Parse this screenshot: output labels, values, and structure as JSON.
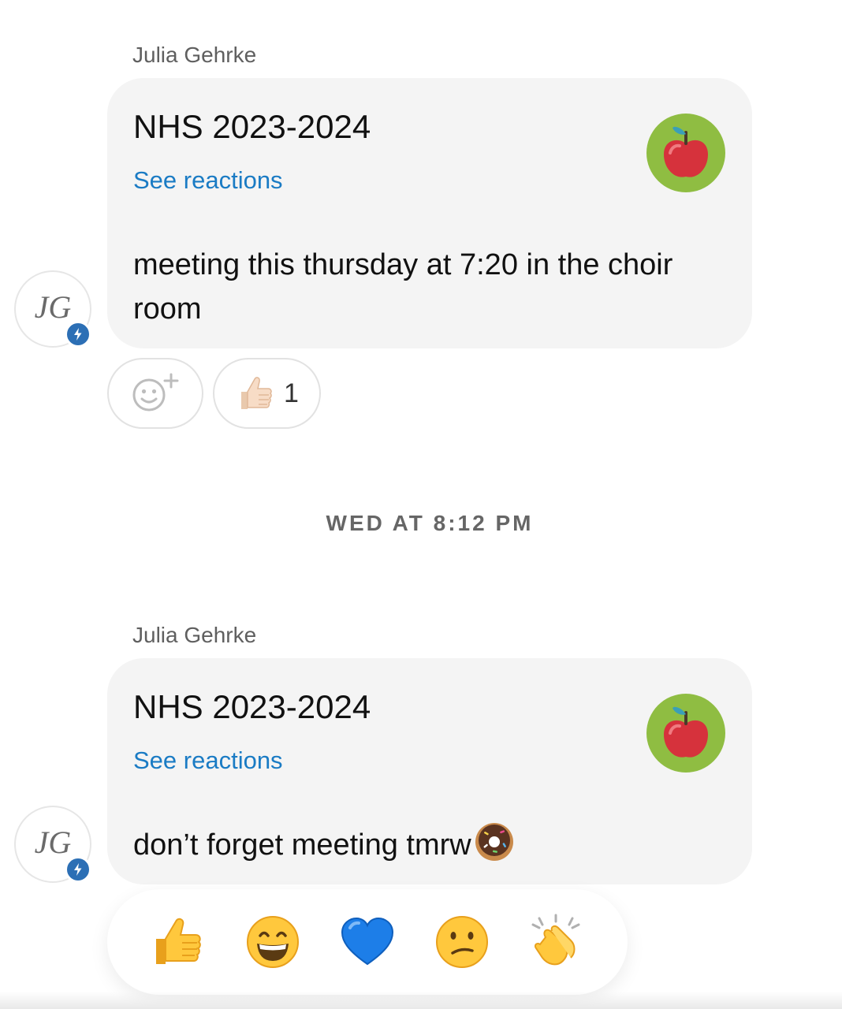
{
  "messages": [
    {
      "sender": "Julia Gehrke",
      "group_title": "NHS 2023-2024",
      "see_reactions": "See reactions",
      "group_icon": "apple-icon",
      "text": "meeting this thursday at 7:20 in the choir room",
      "avatar_initials": "JG",
      "reactions": [
        {
          "emoji": "thumbs-up-light-skin-icon",
          "count": "1"
        }
      ]
    },
    {
      "sender": "Julia Gehrke",
      "group_title": "NHS 2023-2024",
      "see_reactions": "See reactions",
      "group_icon": "apple-icon",
      "text": "don’t forget meeting tmrw",
      "text_emoji": "donut-icon",
      "avatar_initials": "JG"
    }
  ],
  "timestamp": "WED AT 8:12 PM",
  "emoji_tray": [
    "thumbs-up-icon",
    "grinning-face-icon",
    "blue-heart-icon",
    "confused-face-icon",
    "clapping-hands-icon"
  ],
  "colors": {
    "bubble": "#f4f4f4",
    "link": "#1a7bc4",
    "group_icon_bg": "#8fbd42",
    "badge": "#2c6fb5"
  }
}
